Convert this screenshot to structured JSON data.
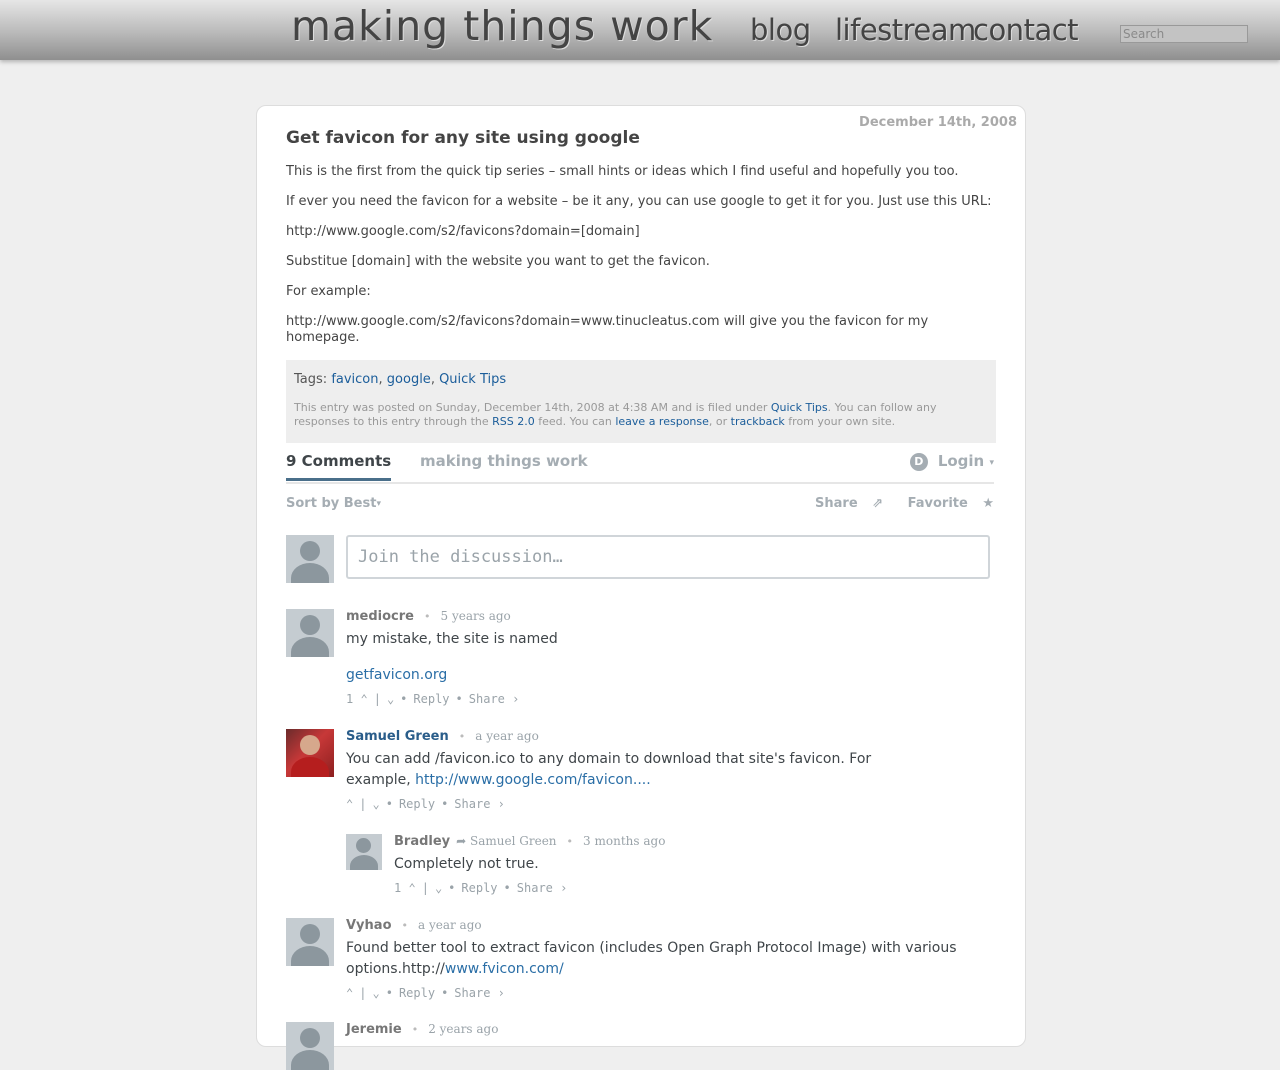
{
  "header": {
    "logo": "making things work",
    "nav": [
      "blog",
      "lifestream",
      "contact"
    ],
    "search_placeholder": "Search"
  },
  "post": {
    "date": "December 14th, 2008",
    "title": "Get favicon for any site using google",
    "paragraphs": [
      "This is the first from the quick tip series – small hints or ideas which I find useful and hopefully you too.",
      "If ever you need the favicon for a website – be it any, you can use google to get it for you. Just use this URL:",
      "http://www.google.com/s2/favicons?domain=[domain]",
      "Substitue [domain] with the website you want to get the favicon.",
      "For example:",
      "http://www.google.com/s2/favicons?domain=www.tinucleatus.com will give you the favicon for my homepage."
    ],
    "tags_label": "Tags:",
    "tags": [
      "favicon",
      "google",
      "Quick Tips"
    ],
    "posted_parts": {
      "t1": "This entry was posted on Sunday, December 14th, 2008 at 4:38 AM and is filed under ",
      "link1": "Quick Tips",
      "t2": ". You can follow any responses to this entry through the ",
      "link2": "RSS 2.0",
      "t3": " feed. You can ",
      "link3": "leave a response",
      "t4": ", or ",
      "link4": "trackback",
      "t5": " from your own site."
    }
  },
  "disqus": {
    "comments_tab": "9 Comments",
    "site_tab": "making things work",
    "login": "Login",
    "sort": "Sort by Best",
    "share": "Share",
    "favorite": "Favorite",
    "composer_placeholder": "Join the discussion…",
    "comments": [
      {
        "author": "mediocre",
        "time": "5 years ago",
        "text": "my mistake, the site is named",
        "link": "getfavicon.org",
        "votes": "1",
        "reply": "Reply",
        "share": "Share ›"
      },
      {
        "author": "Samuel Green",
        "time": "a year ago",
        "text": "You can add /favicon.ico to any domain to download that site's favicon.  For example, ",
        "link": "http://www.google.com/favicon....",
        "votes": "",
        "reply": "Reply",
        "share": "Share ›"
      },
      {
        "author": "Bradley",
        "reply_to": "Samuel Green",
        "time": "3 months ago",
        "text": "Completely not true.",
        "votes": "1",
        "reply": "Reply",
        "share": "Share ›"
      },
      {
        "author": "Vyhao",
        "time": "a year ago",
        "text": "Found better tool to extract favicon (includes Open Graph Protocol Image) with various options.http://",
        "link": "www.fvicon.com/",
        "votes": "",
        "reply": "Reply",
        "share": "Share ›"
      },
      {
        "author": "Jeremie",
        "time": "2 years ago"
      }
    ]
  },
  "colors": {
    "link": "#1b5d9a",
    "muted": "#a5adb3",
    "background": "#efefef"
  }
}
